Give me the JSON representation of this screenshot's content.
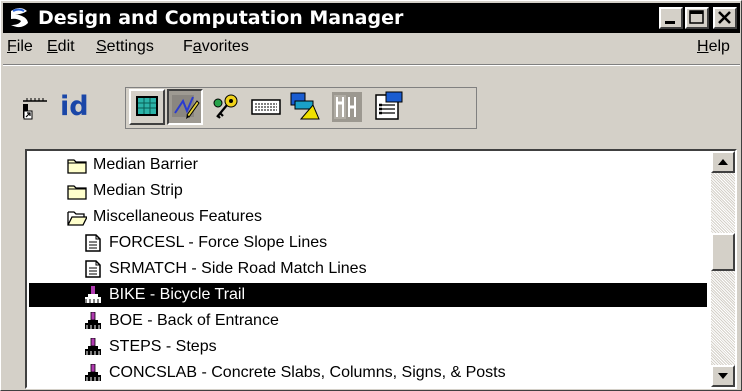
{
  "window": {
    "title": "Design and Computation Manager",
    "title_bar_color": "#000000",
    "controls": [
      "minimize-icon",
      "maximize-icon",
      "close-icon"
    ]
  },
  "menu": {
    "file": {
      "u": "F",
      "rest": "ile"
    },
    "edit": {
      "u": "E",
      "rest": "dit"
    },
    "settings": {
      "u": "S",
      "rest": "ettings"
    },
    "favorites_pre": "F",
    "favorites": {
      "u": "a",
      "rest": "vorites"
    },
    "help": {
      "u": "H",
      "rest": "elp"
    }
  },
  "toolbar": {
    "id_label": "id",
    "tools": [
      "dock-icon",
      "id-icon",
      "monitor-icon",
      "pencil-icon",
      "key-icon",
      "keyboard-icon",
      "shapes-icon",
      "tools-icon",
      "properties-icon"
    ],
    "pressed_tool": "pencil-icon"
  },
  "tree": {
    "items": [
      {
        "icon": "folder-closed-icon",
        "text": "Median Barrier",
        "level": 1
      },
      {
        "icon": "folder-closed-icon",
        "text": "Median Strip",
        "level": 1
      },
      {
        "icon": "folder-open-icon",
        "text": "Miscellaneous Features",
        "level": 1
      },
      {
        "icon": "document-icon",
        "text": "FORCESL - Force Slope Lines",
        "level": 2
      },
      {
        "icon": "document-icon",
        "text": "SRMATCH - Side Road Match Lines",
        "level": 2
      },
      {
        "icon": "brush-icon",
        "text": "BIKE - Bicycle Trail",
        "level": 2,
        "selected": true
      },
      {
        "icon": "brush-icon",
        "text": "BOE - Back of Entrance",
        "level": 2
      },
      {
        "icon": "brush-icon",
        "text": "STEPS - Steps",
        "level": 2
      },
      {
        "icon": "brush-icon",
        "text": "CONCSLAB - Concrete Slabs, Columns, Signs, & Posts",
        "level": 2
      }
    ]
  },
  "colors": {
    "window_bg": "#d4d0c8",
    "selection_bg": "#000000",
    "selection_text": "#ffffff",
    "id_text": "#1a46a8"
  }
}
